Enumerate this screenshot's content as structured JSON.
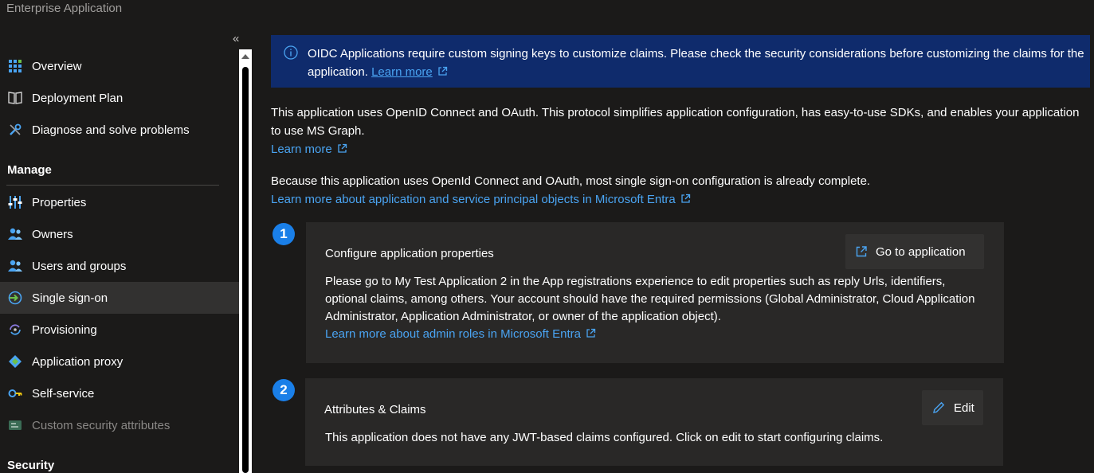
{
  "app": {
    "title": "Enterprise Application"
  },
  "sidebar": {
    "collapse_glyph": "«",
    "items_top": [
      {
        "label": "Overview",
        "icon": "grid-icon"
      },
      {
        "label": "Deployment Plan",
        "icon": "book-icon"
      },
      {
        "label": "Diagnose and solve problems",
        "icon": "wrench-icon"
      }
    ],
    "manage_header": "Manage",
    "manage_items": [
      {
        "label": "Properties",
        "icon": "sliders-icon"
      },
      {
        "label": "Owners",
        "icon": "people-icon"
      },
      {
        "label": "Users and groups",
        "icon": "people-icon"
      },
      {
        "label": "Single sign-on",
        "icon": "sign-in-icon",
        "selected": true
      },
      {
        "label": "Provisioning",
        "icon": "sync-icon"
      },
      {
        "label": "Application proxy",
        "icon": "proxy-icon"
      },
      {
        "label": "Self-service",
        "icon": "key-icon"
      },
      {
        "label": "Custom security attributes",
        "icon": "tag-icon",
        "disabled": true
      }
    ],
    "security_header": "Security"
  },
  "main": {
    "banner": {
      "text": "OIDC Applications require custom signing keys to customize claims. Please check the security considerations before customizing the claims for the application.",
      "link": "Learn more",
      "color": "#0f2b6c"
    },
    "intro": {
      "text": "This application uses OpenID Connect and OAuth. This protocol simplifies application configuration, has easy-to-use SDKs, and enables your application to use MS Graph.",
      "link": "Learn more"
    },
    "sso": {
      "text": "Because this application uses OpenId Connect and OAuth, most single sign-on configuration is already complete.",
      "link": "Learn more about application and service principal objects in Microsoft Entra"
    },
    "step1": {
      "number": "1",
      "title": "Configure application properties",
      "button": "Go to application",
      "body": "Please go to My Test Application 2 in the App registrations experience to edit properties such as reply Urls, identifiers, optional claims, among others. Your account should have the required permissions (Global Administrator, Cloud Application Administrator, Application Administrator, or owner of the application object).",
      "link": "Learn more about admin roles in Microsoft Entra"
    },
    "step2": {
      "number": "2",
      "title": "Attributes & Claims",
      "button": "Edit",
      "body": "This application does not have any JWT-based claims configured. Click on edit to start configuring claims."
    }
  },
  "colors": {
    "accent": "#4aa4f2",
    "step_badge": "#1a7fe8",
    "selected_bg": "#323130",
    "card_bg": "#292827"
  }
}
